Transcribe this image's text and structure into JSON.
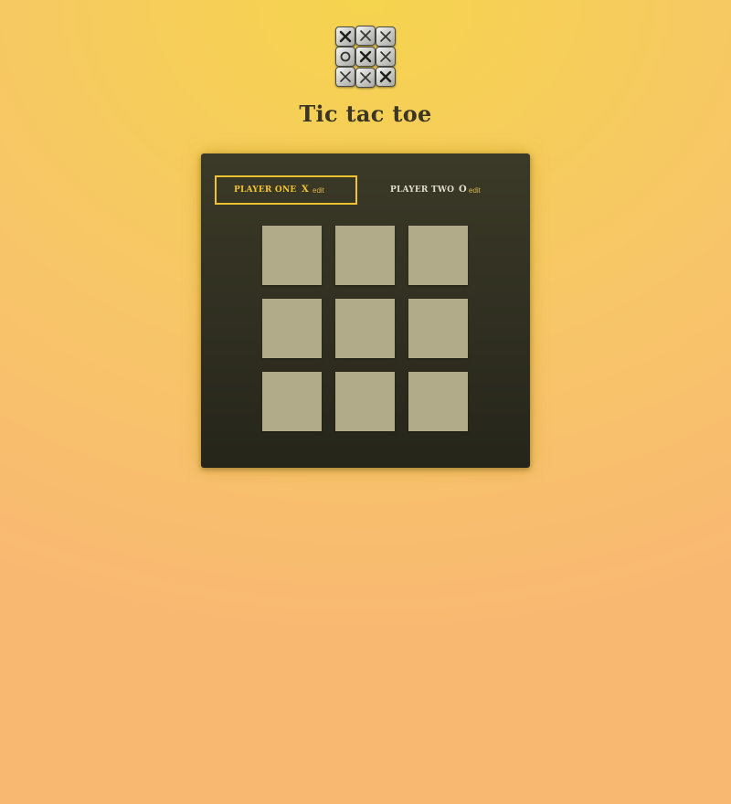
{
  "header": {
    "logo_icon": "tic-tac-toe-logo-icon",
    "title": "Tic tac toe"
  },
  "players": [
    {
      "name": "PLAYER ONE",
      "symbol": "X",
      "edit_label": "edit",
      "active": true
    },
    {
      "name": "PLAYER TWO",
      "symbol": "O",
      "edit_label": "edit",
      "active": false
    }
  ],
  "board": {
    "cells": [
      "",
      "",
      "",
      "",
      "",
      "",
      "",
      "",
      ""
    ]
  },
  "colors": {
    "background_top": "#f5d44e",
    "background_bottom": "#f9b872",
    "panel": "#2e2d20",
    "active_accent": "#f2c230",
    "cell": "#b1ab8a",
    "title_text": "#3b3624"
  }
}
